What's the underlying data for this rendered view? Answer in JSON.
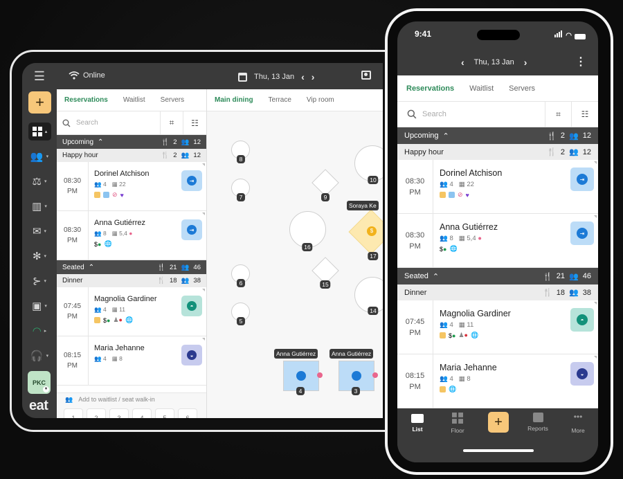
{
  "tablet": {
    "status": "Online",
    "date": "Thu, 13 Jan",
    "rail": {
      "add_label": "+",
      "user_badge": "PKC",
      "logo": "eat",
      "items": [
        "guests-icon",
        "staff-icon",
        "reports-icon",
        "mail-icon",
        "network-icon",
        "flow-icon",
        "badge-icon",
        "gauge-icon",
        "support-icon"
      ]
    },
    "list_tabs": [
      "Reservations",
      "Waitlist",
      "Servers"
    ],
    "search_placeholder": "Search",
    "sections": [
      {
        "title": "Upcoming",
        "tables": "2",
        "guests": "12",
        "groups": [
          {
            "name": "Happy hour",
            "tables": "2",
            "guests": "12",
            "reservations": [
              {
                "time": "08:30",
                "ampm": "PM",
                "name": "Dorinel Atchison",
                "party": "4",
                "table": "22",
                "tags": [
                  "note",
                  "chat",
                  "no-stroller",
                  "heart"
                ],
                "status": "arriving",
                "status_color": "#1c7ad6",
                "status_bg": "#bcdcf7"
              },
              {
                "time": "08:30",
                "ampm": "PM",
                "name": "Anna Gutiérrez",
                "party": "8",
                "table": "5,4",
                "tags": [
                  "paid",
                  "web"
                ],
                "status": "arriving",
                "status_color": "#1c7ad6",
                "status_bg": "#bcdcf7"
              }
            ]
          }
        ]
      },
      {
        "title": "Seated",
        "tables": "21",
        "guests": "46",
        "groups": [
          {
            "name": "Dinner",
            "tables": "18",
            "guests": "38",
            "reservations": [
              {
                "time": "07:45",
                "ampm": "PM",
                "name": "Magnolia Gardiner",
                "party": "4",
                "table": "11",
                "tags": [
                  "note",
                  "paid",
                  "declined",
                  "web"
                ],
                "status": "served",
                "status_color": "#12917a",
                "status_bg": "#b6e3da"
              },
              {
                "time": "08:15",
                "ampm": "PM",
                "name": "Maria Jehanne",
                "party": "4",
                "table": "8",
                "tags": [
                  "note",
                  "web"
                ],
                "status": "dessert",
                "status_color": "#2b3a8f",
                "status_bg": "#c7cbee"
              }
            ]
          }
        ]
      }
    ],
    "walkin_label": "Add to waitlist / seat walk-in",
    "walkin_tables": [
      "1",
      "2",
      "3",
      "4",
      "5",
      "6"
    ],
    "floor_tabs": [
      "Main dining",
      "Terrace",
      "Vip room"
    ],
    "floor_tables": [
      {
        "num": "8",
        "shape": "round"
      },
      {
        "num": "7",
        "shape": "round"
      },
      {
        "num": "6",
        "shape": "round"
      },
      {
        "num": "5",
        "shape": "round"
      },
      {
        "num": "9",
        "shape": "diamond"
      },
      {
        "num": "15",
        "shape": "diamond"
      },
      {
        "num": "16",
        "shape": "round"
      },
      {
        "num": "10",
        "shape": "round"
      },
      {
        "num": "14",
        "shape": "round"
      },
      {
        "num": "17",
        "shape": "diamond",
        "guest": "Soraya Ke",
        "status": "paid"
      },
      {
        "num": "4",
        "shape": "square",
        "guest": "Anna Gutiérrez",
        "status": "arriving"
      },
      {
        "num": "3",
        "shape": "square",
        "guest": "Anna Gutiérrez",
        "status": "arriving"
      }
    ]
  },
  "phone": {
    "clock": "9:41",
    "date": "Thu, 13 Jan",
    "tabs": [
      "Reservations",
      "Waitlist",
      "Servers"
    ],
    "search_placeholder": "Search",
    "nav": [
      {
        "label": "List",
        "icon": "list-icon",
        "active": true
      },
      {
        "label": "Floor",
        "icon": "floor-icon",
        "active": false
      },
      {
        "label": "+",
        "icon": "add-icon",
        "active": false
      },
      {
        "label": "Reports",
        "icon": "reports-icon",
        "active": false
      },
      {
        "label": "More",
        "icon": "more-icon",
        "active": false
      }
    ]
  },
  "colors": {
    "accent_green": "#2e8b5a",
    "add_button": "#f7c77a",
    "chrome_dark": "#3a3a3a",
    "section_header": "#4a4a4a"
  }
}
